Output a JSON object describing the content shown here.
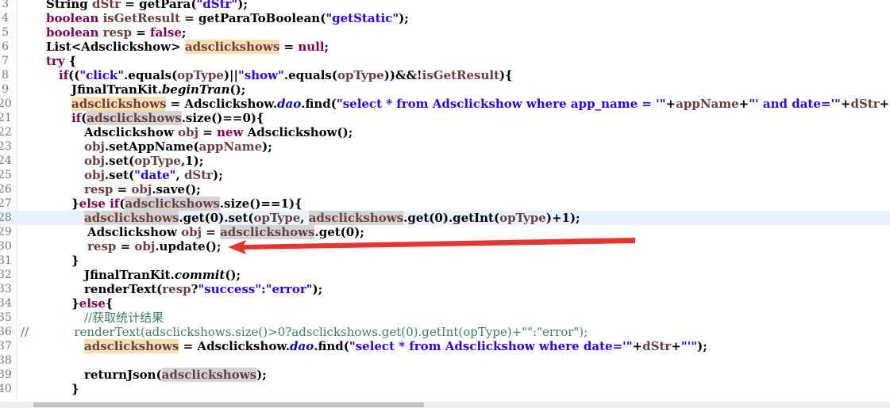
{
  "colors": {
    "keyword": "#7f0055",
    "string": "#2a00ff",
    "variable": "#6a3e3e",
    "comment": "#3f7f5f",
    "field": "#0000c0",
    "highlight_write": "#f9dfb4",
    "highlight_read": "#d4d4d4",
    "current_line": "#e8f2fe",
    "arrow": "#e8332e"
  },
  "editor": {
    "current_line": "28",
    "lines": [
      {
        "num": "3",
        "indent": 58,
        "tokens": [
          [
            "String ",
            ""
          ],
          [
            "dStr",
            "var"
          ],
          [
            " = getPara(",
            ""
          ],
          [
            "\"dStr\"",
            "str"
          ],
          [
            ");",
            ""
          ]
        ]
      },
      {
        "num": "4",
        "indent": 58,
        "tokens": [
          [
            "boolean ",
            "kw"
          ],
          [
            "isGetResult",
            "var"
          ],
          [
            " = getParaToBoolean(",
            ""
          ],
          [
            "\"getStatic\"",
            "str"
          ],
          [
            ");",
            ""
          ]
        ]
      },
      {
        "num": "5",
        "indent": 58,
        "tokens": [
          [
            "boolean ",
            "kw"
          ],
          [
            "resp",
            "var"
          ],
          [
            " = ",
            ""
          ],
          [
            "false",
            "kw"
          ],
          [
            ";",
            ""
          ]
        ]
      },
      {
        "num": "6",
        "indent": 58,
        "tokens": [
          [
            "List<Adsclickshow> ",
            ""
          ],
          [
            "adsclickshows",
            "hlo"
          ],
          [
            " = ",
            ""
          ],
          [
            "null",
            "kw"
          ],
          [
            ";",
            ""
          ]
        ]
      },
      {
        "num": "7",
        "indent": 58,
        "tokens": [
          [
            "try",
            "kw"
          ],
          [
            " {",
            ""
          ]
        ]
      },
      {
        "num": "8",
        "indent": 74,
        "tokens": [
          [
            "if",
            "kw"
          ],
          [
            "((",
            ""
          ],
          [
            "\"click\"",
            "str"
          ],
          [
            ".equals(",
            ""
          ],
          [
            "opType",
            "var"
          ],
          [
            ")||",
            ""
          ],
          [
            "\"show\"",
            "str"
          ],
          [
            ".equals(",
            ""
          ],
          [
            "opType",
            "var"
          ],
          [
            "))&&!",
            ""
          ],
          [
            "isGetResult",
            "var"
          ],
          [
            "){",
            ""
          ]
        ]
      },
      {
        "num": "9",
        "indent": 90,
        "tokens": [
          [
            "JfinalTranKit.",
            ""
          ],
          [
            "beginTran",
            "it"
          ],
          [
            "();",
            ""
          ]
        ]
      },
      {
        "num": "20",
        "indent": 90,
        "tokens": [
          [
            "adsclickshows",
            "hlo"
          ],
          [
            " = Adsclickshow.",
            ""
          ],
          [
            "dao",
            "itb"
          ],
          [
            ".find(",
            ""
          ],
          [
            "\"select * from Adsclickshow where app_name = '\"",
            "str"
          ],
          [
            "+",
            ""
          ],
          [
            "appName",
            "var"
          ],
          [
            "+",
            ""
          ],
          [
            "\"' and date='\"",
            "str"
          ],
          [
            "+",
            ""
          ],
          [
            "dStr",
            "var"
          ],
          [
            "+",
            ""
          ],
          [
            "\"'\"",
            "str"
          ],
          [
            ");",
            ""
          ]
        ]
      },
      {
        "num": "21",
        "indent": 90,
        "tokens": [
          [
            "if",
            "kw"
          ],
          [
            "(",
            ""
          ],
          [
            "adsclickshows",
            "hlg"
          ],
          [
            ".size()==0){",
            ""
          ]
        ]
      },
      {
        "num": "22",
        "indent": 106,
        "tokens": [
          [
            "Adsclickshow ",
            ""
          ],
          [
            "obj",
            "var"
          ],
          [
            " = ",
            ""
          ],
          [
            "new",
            "kw"
          ],
          [
            " Adsclickshow();",
            ""
          ]
        ]
      },
      {
        "num": "23",
        "indent": 106,
        "tokens": [
          [
            "obj",
            "var"
          ],
          [
            ".setAppName(",
            ""
          ],
          [
            "appName",
            "var"
          ],
          [
            ");",
            ""
          ]
        ]
      },
      {
        "num": "24",
        "indent": 106,
        "tokens": [
          [
            "obj",
            "var"
          ],
          [
            ".set(",
            ""
          ],
          [
            "opType",
            "var"
          ],
          [
            ",1);",
            ""
          ]
        ]
      },
      {
        "num": "25",
        "indent": 106,
        "tokens": [
          [
            "obj",
            "var"
          ],
          [
            ".set(",
            ""
          ],
          [
            "\"date\"",
            "str"
          ],
          [
            ", ",
            ""
          ],
          [
            "dStr",
            "var"
          ],
          [
            ");",
            ""
          ]
        ]
      },
      {
        "num": "26",
        "indent": 106,
        "tokens": [
          [
            "resp",
            "var"
          ],
          [
            " = ",
            ""
          ],
          [
            "obj",
            "var"
          ],
          [
            ".save();",
            ""
          ]
        ]
      },
      {
        "num": "27",
        "indent": 90,
        "tokens": [
          [
            "}",
            ""
          ],
          [
            "else if",
            "kw"
          ],
          [
            "(",
            ""
          ],
          [
            "adsclickshows",
            "hlg"
          ],
          [
            ".size()==1){",
            ""
          ]
        ]
      },
      {
        "num": "28",
        "indent": 106,
        "tokens": [
          [
            "adsclickshows",
            "hlg"
          ],
          [
            ".get(0).set(",
            ""
          ],
          [
            "opType",
            "var"
          ],
          [
            ", ",
            ""
          ],
          [
            "adsclickshows",
            "hlg"
          ],
          [
            ".get(0).getInt(",
            ""
          ],
          [
            "opType",
            "var"
          ],
          [
            ")+1);",
            ""
          ]
        ]
      },
      {
        "num": "29",
        "indent": 110,
        "tokens": [
          [
            "Adsclickshow ",
            ""
          ],
          [
            "obj",
            "var"
          ],
          [
            " = ",
            ""
          ],
          [
            "adsclickshows",
            "hlg"
          ],
          [
            ".get(0);",
            ""
          ]
        ]
      },
      {
        "num": "30",
        "indent": 110,
        "tokens": [
          [
            "resp",
            "var"
          ],
          [
            " = ",
            ""
          ],
          [
            "obj",
            "var"
          ],
          [
            ".update();",
            ""
          ]
        ]
      },
      {
        "num": "31",
        "indent": 90,
        "tokens": [
          [
            "}",
            ""
          ]
        ]
      },
      {
        "num": "32",
        "indent": 106,
        "tokens": [
          [
            "JfinalTranKit.",
            ""
          ],
          [
            "commit",
            "it"
          ],
          [
            "();",
            ""
          ]
        ]
      },
      {
        "num": "33",
        "indent": 106,
        "tokens": [
          [
            "renderText(",
            ""
          ],
          [
            "resp",
            "var"
          ],
          [
            "?",
            ""
          ],
          [
            "\"success\"",
            "str"
          ],
          [
            ":",
            ""
          ],
          [
            "\"error\"",
            "str"
          ],
          [
            ");",
            ""
          ]
        ]
      },
      {
        "num": "34",
        "indent": 90,
        "tokens": [
          [
            "}",
            ""
          ],
          [
            "else",
            "kw"
          ],
          [
            "{",
            ""
          ]
        ]
      },
      {
        "num": "35",
        "indent": 106,
        "tokens": [
          [
            "//获取统计结果",
            "com"
          ]
        ]
      },
      {
        "num": "36",
        "indent": 26,
        "tokens": [
          [
            "//            renderText(adsclickshows.size()>0?adsclickshows.get(0).getInt(opType)+\"\":\"error\");",
            "com"
          ]
        ]
      },
      {
        "num": "37",
        "indent": 106,
        "tokens": [
          [
            "adsclickshows",
            "hlo"
          ],
          [
            " = Adsclickshow.",
            ""
          ],
          [
            "dao",
            "itb"
          ],
          [
            ".find(",
            ""
          ],
          [
            "\"select * from Adsclickshow where date='\"",
            "str"
          ],
          [
            "+",
            ""
          ],
          [
            "dStr",
            "var"
          ],
          [
            "+",
            ""
          ],
          [
            "\"'\"",
            "str"
          ],
          [
            ");",
            ""
          ]
        ]
      },
      {
        "num": "38",
        "indent": 106,
        "tokens": []
      },
      {
        "num": "39",
        "indent": 106,
        "tokens": [
          [
            "returnJson(",
            ""
          ],
          [
            "adsclickshows",
            "hlg"
          ],
          [
            ");",
            ""
          ]
        ]
      },
      {
        "num": "40",
        "indent": 90,
        "tokens": [
          [
            "}",
            ""
          ]
        ]
      }
    ]
  }
}
